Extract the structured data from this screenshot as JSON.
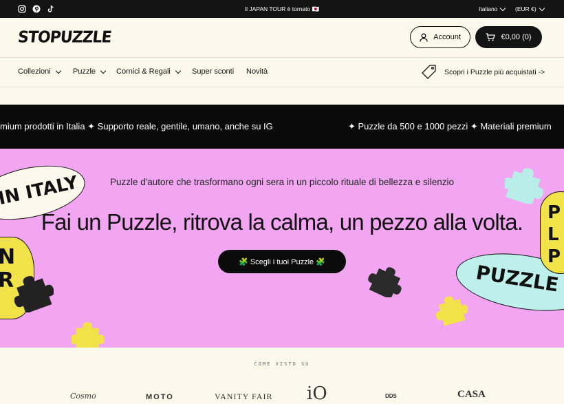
{
  "topbar": {
    "announcement": "Il JAPAN TOUR è tornato 🇯🇵",
    "language": "Italiano",
    "currency": "(EUR €)",
    "social_icons": [
      "instagram-icon",
      "pinterest-icon",
      "tiktok-icon"
    ]
  },
  "header": {
    "logo_text": "STOPUZZLE",
    "account_label": "Account",
    "cart_label": "€0,00 (0)"
  },
  "nav": {
    "items": [
      {
        "label": "Collezioni",
        "has_dropdown": true
      },
      {
        "label": "Puzzle",
        "has_dropdown": true
      },
      {
        "label": "Cornici & Regali",
        "has_dropdown": true
      },
      {
        "label": "Super sconti",
        "has_dropdown": false
      },
      {
        "label": "Novità",
        "has_dropdown": false
      }
    ],
    "promo_label": "Scopri i Puzzle più acquistati ->"
  },
  "marquee": {
    "text_a": "mium prodotti in Italia ✦ Supporto reale, gentile, umano, anche su IG",
    "text_b": "✦ Puzzle da 500 e 1000 pezzi ✦ Materiali premium"
  },
  "hero": {
    "subtitle": "Puzzle d'autore che trasformano ogni sera in un piccolo rituale di bellezza e silenzio",
    "title": "Fai un Puzzle, ritrova la calma, un pezzo alla volta.",
    "cta_label": "🧩 Scegli i tuoi Puzzle 🧩",
    "sticker_left_top": "IN ITALY",
    "sticker_left_mid": "N\nR",
    "sticker_right": "PUZZLE U",
    "sticker_right_top": "P\nL\nP"
  },
  "press": {
    "label": "COME VISTO SU",
    "logos": [
      "Cosmo",
      "MOTO",
      "VANITY FAIR",
      "iO",
      "DDS",
      "CASA"
    ]
  },
  "colors": {
    "hero_bg": "#f2a6f2",
    "dark": "#141414",
    "cream": "#fcf8ec",
    "mint": "#bdf0ea",
    "yellow": "#f2e24a"
  }
}
